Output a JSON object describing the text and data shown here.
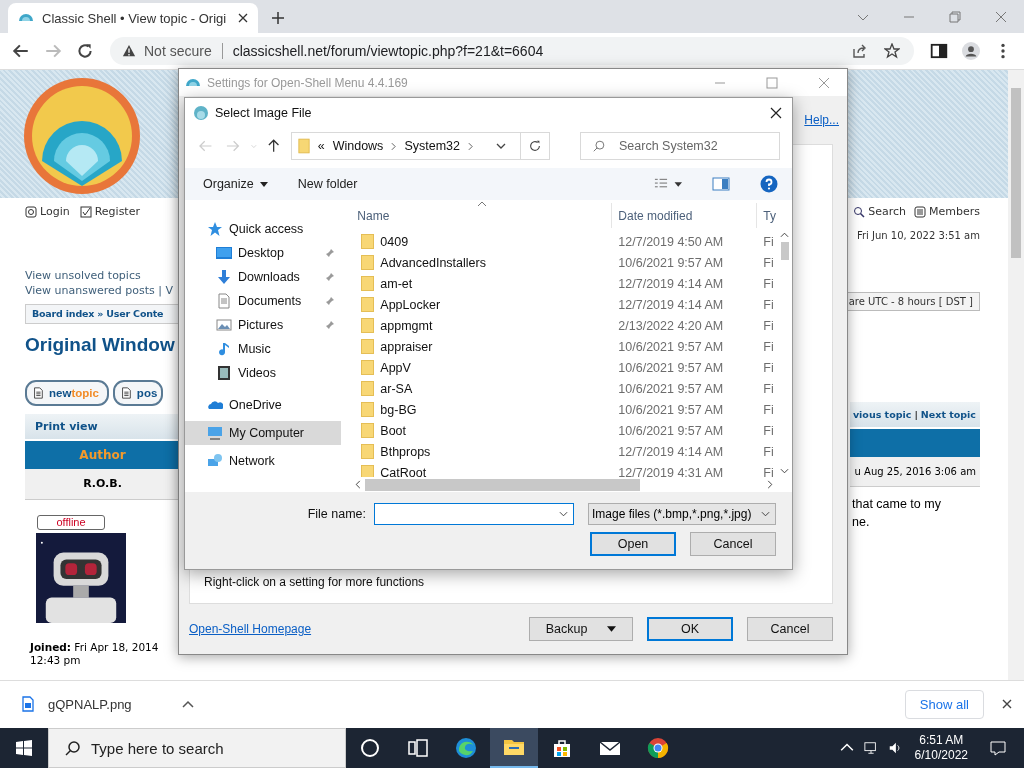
{
  "browser": {
    "tab": {
      "title": "Classic Shell • View topic - Origi"
    },
    "nav": {
      "back_disabled": false,
      "forward_disabled": true
    },
    "address": {
      "security": "Not secure",
      "url": "classicshell.net/forum/viewtopic.php?f=21&t=6604"
    }
  },
  "forum": {
    "login": "Login",
    "register": "Register",
    "links": [
      "View unsolved topics",
      "View unanswered posts | V"
    ],
    "breadcrumb": "Board index » User Conte",
    "topic_title": "Original Window",
    "buttons": [
      {
        "parts": [
          "new",
          "topic"
        ]
      },
      {
        "parts": [
          "pos"
        ]
      }
    ],
    "print_view": "Print view",
    "author_header": "Author",
    "author": "R.O.B.",
    "status": "offline",
    "joined": "**Joined:** Fri Apr 18, 2014 12:43 pm",
    "search": "Search",
    "members": "Members",
    "current_time": "Fri Jun 10, 2022 3:51 am",
    "timezone": "are UTC - 8 hours [ DST ]",
    "topic_nav": [
      "vious topic",
      "|",
      "Next topic"
    ],
    "post_date": "u Aug 25, 2016 3:06 am",
    "post_text": [
      "that came to my",
      "ne."
    ]
  },
  "settings_window": {
    "title": "Settings for Open-Shell Menu 4.4.169",
    "help_link": "Help...",
    "hint": "Right-click on a setting for more functions",
    "homepage_link": "Open-Shell Homepage",
    "buttons": [
      {
        "label": "Backup",
        "kind": "split",
        "default": false
      },
      {
        "label": "OK",
        "kind": "plain",
        "default": true
      },
      {
        "label": "Cancel",
        "kind": "plain",
        "default": false
      }
    ]
  },
  "file_dialog": {
    "title": "Select Image File",
    "nav_back_disabled": true,
    "nav_forward_disabled": true,
    "path": [
      "«",
      "Windows",
      "System32"
    ],
    "search": {
      "placeholder": "Search System32"
    },
    "toolbar": [
      "Organize",
      "New folder"
    ],
    "sidebar": [
      {
        "label": "Quick access",
        "selected": false,
        "children": [
          {
            "label": "Desktop",
            "pinned": true,
            "selected": false
          },
          {
            "label": "Downloads",
            "pinned": true,
            "selected": false
          },
          {
            "label": "Documents",
            "pinned": true,
            "selected": false
          },
          {
            "label": "Pictures",
            "pinned": true,
            "selected": false
          },
          {
            "label": "Music",
            "pinned": false,
            "selected": false
          },
          {
            "label": "Videos",
            "pinned": false,
            "selected": false
          }
        ]
      },
      {
        "label": "OneDrive",
        "selected": false
      },
      {
        "label": "My Computer",
        "selected": true
      },
      {
        "label": "Network",
        "selected": false
      }
    ],
    "columns": [
      "Name",
      "Date modified",
      "Ty"
    ],
    "rows": [
      {
        "name": "0409",
        "date": "12/7/2019 4:50 AM",
        "type": "Fi"
      },
      {
        "name": "AdvancedInstallers",
        "date": "10/6/2021 9:57 AM",
        "type": "Fi"
      },
      {
        "name": "am-et",
        "date": "12/7/2019 4:14 AM",
        "type": "Fi"
      },
      {
        "name": "AppLocker",
        "date": "12/7/2019 4:14 AM",
        "type": "Fi"
      },
      {
        "name": "appmgmt",
        "date": "2/13/2022 4:20 AM",
        "type": "Fi"
      },
      {
        "name": "appraiser",
        "date": "10/6/2021 9:57 AM",
        "type": "Fi"
      },
      {
        "name": "AppV",
        "date": "10/6/2021 9:57 AM",
        "type": "Fi"
      },
      {
        "name": "ar-SA",
        "date": "10/6/2021 9:57 AM",
        "type": "Fi"
      },
      {
        "name": "bg-BG",
        "date": "10/6/2021 9:57 AM",
        "type": "Fi"
      },
      {
        "name": "Boot",
        "date": "10/6/2021 9:57 AM",
        "type": "Fi"
      },
      {
        "name": "Bthprops",
        "date": "12/7/2019 4:14 AM",
        "type": "Fi"
      },
      {
        "name": "CatRoot",
        "date": "12/7/2019 4:31 AM",
        "type": "Fi"
      }
    ],
    "file_name_label": "File name:",
    "filter": "Image files (*.bmp,*.png,*.jpg)",
    "buttons": [
      {
        "label": "Open",
        "default": true
      },
      {
        "label": "Cancel",
        "default": false
      }
    ]
  },
  "downloads": {
    "file": "gQPNALP.png",
    "show_all": "Show all"
  },
  "taskbar": {
    "search_placeholder": "Type here to search",
    "time": "6:51 AM",
    "date": "6/10/2022",
    "apps": [
      {
        "selected": false
      },
      {
        "selected": false
      },
      {
        "selected": false
      },
      {
        "selected": true
      },
      {
        "selected": false
      },
      {
        "selected": false
      },
      {
        "selected": false
      }
    ]
  }
}
